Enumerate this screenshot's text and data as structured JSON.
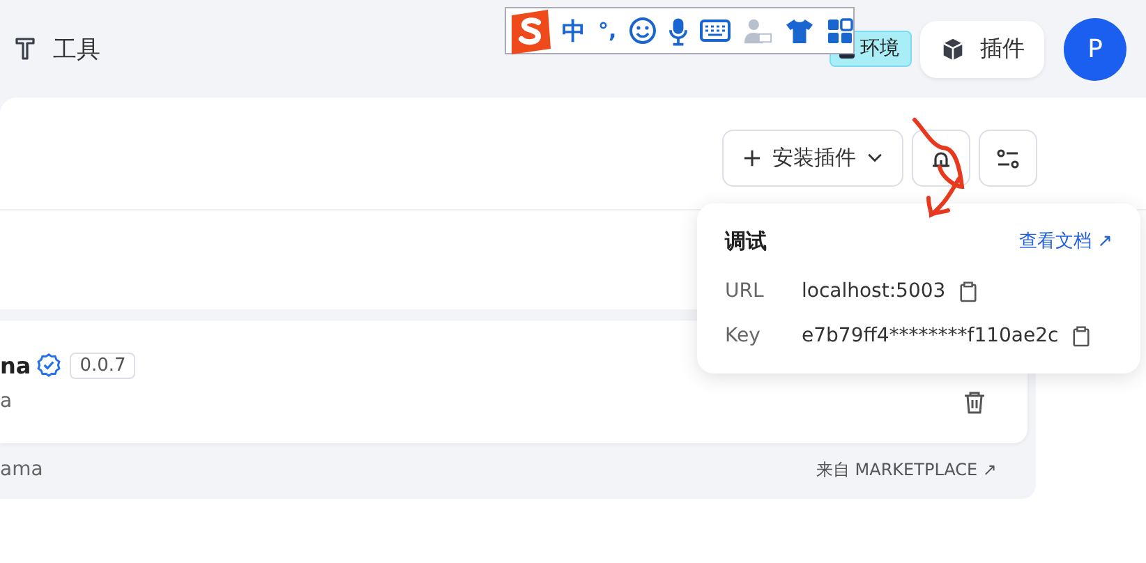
{
  "header": {
    "section": "工具",
    "badge": "环境",
    "plugin_button": "插件",
    "avatar": "P"
  },
  "toolbar": {
    "install_button": "安装插件"
  },
  "debug_popover": {
    "title": "调试",
    "docs_link": "查看文档 ↗",
    "rows": [
      {
        "label": "URL",
        "value": "localhost:5003"
      },
      {
        "label": "Key",
        "value": "e7b79ff4********f110ae2c"
      }
    ]
  },
  "plugin_card": {
    "name": "na",
    "verified": true,
    "version": "0.0.7",
    "description": "a",
    "author": "ama",
    "source": "来自 MARKETPLACE ↗"
  },
  "ime_toolbar": {
    "mode": "中",
    "punctuation": "°,"
  }
}
